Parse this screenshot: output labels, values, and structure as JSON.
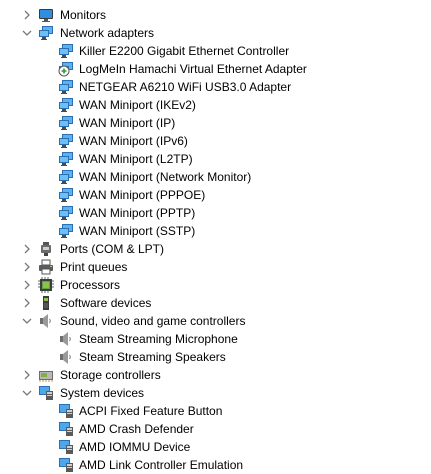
{
  "tree": {
    "categories": [
      {
        "label": "Monitors",
        "expanded": false,
        "icon": "monitor-icon"
      },
      {
        "label": "Network adapters",
        "expanded": true,
        "icon": "network-adapter-icon",
        "children": [
          {
            "label": "Killer E2200 Gigabit Ethernet Controller",
            "icon": "network-adapter-icon"
          },
          {
            "label": "LogMeIn Hamachi Virtual Ethernet Adapter",
            "icon": "network-adapter-warning-icon"
          },
          {
            "label": "NETGEAR A6210 WiFi USB3.0 Adapter",
            "icon": "network-adapter-icon"
          },
          {
            "label": "WAN Miniport (IKEv2)",
            "icon": "network-adapter-icon"
          },
          {
            "label": "WAN Miniport (IP)",
            "icon": "network-adapter-icon"
          },
          {
            "label": "WAN Miniport (IPv6)",
            "icon": "network-adapter-icon"
          },
          {
            "label": "WAN Miniport (L2TP)",
            "icon": "network-adapter-icon"
          },
          {
            "label": "WAN Miniport (Network Monitor)",
            "icon": "network-adapter-icon"
          },
          {
            "label": "WAN Miniport (PPPOE)",
            "icon": "network-adapter-icon"
          },
          {
            "label": "WAN Miniport (PPTP)",
            "icon": "network-adapter-icon"
          },
          {
            "label": "WAN Miniport (SSTP)",
            "icon": "network-adapter-icon"
          }
        ]
      },
      {
        "label": "Ports (COM & LPT)",
        "expanded": false,
        "icon": "port-icon"
      },
      {
        "label": "Print queues",
        "expanded": false,
        "icon": "printer-icon"
      },
      {
        "label": "Processors",
        "expanded": false,
        "icon": "processor-icon"
      },
      {
        "label": "Software devices",
        "expanded": false,
        "icon": "software-device-icon"
      },
      {
        "label": "Sound, video and game controllers",
        "expanded": true,
        "icon": "speaker-icon",
        "children": [
          {
            "label": "Steam Streaming Microphone",
            "icon": "speaker-icon"
          },
          {
            "label": "Steam Streaming Speakers",
            "icon": "speaker-icon"
          }
        ]
      },
      {
        "label": "Storage controllers",
        "expanded": false,
        "icon": "storage-controller-icon"
      },
      {
        "label": "System devices",
        "expanded": true,
        "icon": "system-device-icon",
        "children": [
          {
            "label": "ACPI Fixed Feature Button",
            "icon": "system-device-icon"
          },
          {
            "label": "AMD Crash Defender",
            "icon": "system-device-icon"
          },
          {
            "label": "AMD IOMMU Device",
            "icon": "system-device-icon"
          },
          {
            "label": "AMD Link Controller Emulation",
            "icon": "system-device-icon"
          }
        ]
      }
    ]
  },
  "colors": {
    "chevron": "#7a7a7a",
    "monitor_blue": "#2a8ad8",
    "adapter_blue": "#3b8fd8",
    "warning_green": "#2e9a3e"
  }
}
